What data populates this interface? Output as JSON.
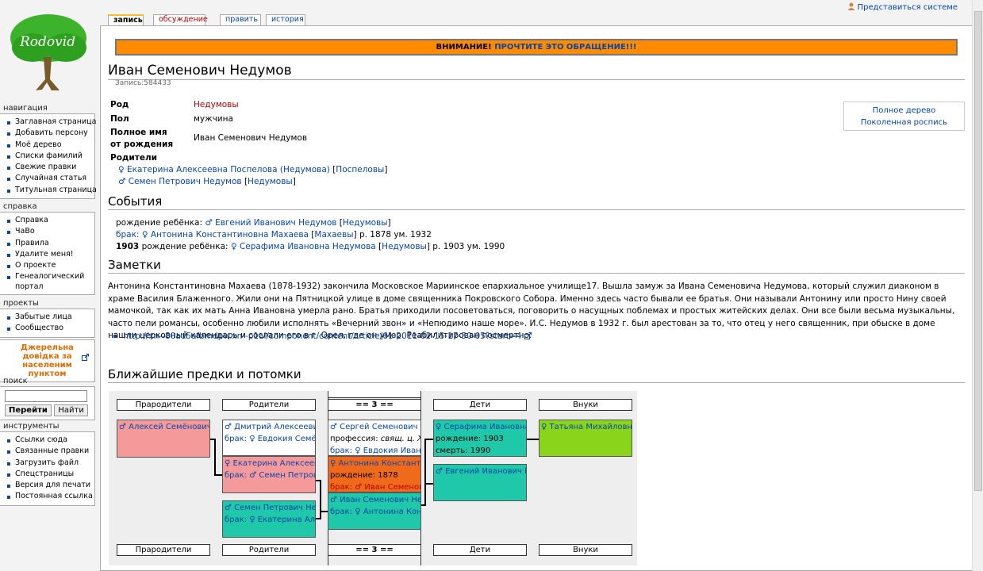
{
  "logo": {
    "text": "Rodovid",
    "icon": "tree-logo"
  },
  "sidebar": {
    "navigation": {
      "title": "навигация",
      "items": [
        "Заглавная страница",
        "Добавить персону",
        "Моё дерево",
        "Списки фамилий",
        "Свежие правки",
        "Случайная статья",
        "Титульная страница"
      ]
    },
    "help": {
      "title": "справка",
      "items": [
        "Справка",
        "ЧаВо",
        "Правила",
        "Удалите меня!",
        "О проекте",
        "Генеалогический портал"
      ]
    },
    "projects": {
      "title": "проекты",
      "items": [
        "Забытые лица",
        "Сообщество"
      ]
    },
    "special": {
      "text": "Джерельна довідка за населеним пунктом",
      "icon": "external-link-icon"
    },
    "search": {
      "title": "поиск",
      "go": "Перейти",
      "find": "Найти"
    },
    "tools": {
      "title": "инструменты",
      "items": [
        "Ссылки сюда",
        "Связанные правки",
        "Загрузить файл",
        "Спецстраницы",
        "Версия для печати",
        "Постоянная ссылка"
      ]
    }
  },
  "top": {
    "login": "Представиться системе",
    "tabs": [
      "запись",
      "обсуждение",
      "править",
      "история"
    ]
  },
  "notice": {
    "prefix": "ВНИМАНИЕ!",
    "link": "ПРОЧТИТЕ ЭТО ОБРАЩЕНИЕ!!!"
  },
  "person": {
    "title": "Иван Семенович Недумов",
    "record": "Запись:584433",
    "rod_label": "Род",
    "rod_value": "Недумовы",
    "sex_label": "Пол",
    "sex_value": "мужчина",
    "fullname_label1": "Полное имя",
    "fullname_label2": "от рождения",
    "fullname_value": "Иван Семенович Недумов",
    "parents_label": "Родители",
    "mother": "♀ Екатерина Алексеевна Поспелова (Недумова)",
    "mother_rod": "Поспеловы",
    "father": "♂ Семен Петрович Недумов",
    "father_rod": "Недумовы"
  },
  "sidebox": {
    "tree": "Полное дерево",
    "list": "Поколенная роспись"
  },
  "events": {
    "title": "События",
    "e1_prefix": "рождение ребёнка:",
    "e1_person": "♂ Евгений Иванович Недумов",
    "e1_rod": "Недумовы",
    "e2_prefix": "брак:",
    "e2_person": "♀ Антонина Константиновна Махаева",
    "e2_rod": "Махаевы",
    "e2_suffix": "р. 1878 ум. 1932",
    "e3_year": "1903",
    "e3_prefix": "рождение ребёнка:",
    "e3_person": "♀ Серафима Ивановна Недумова",
    "e3_rod": "Недумовы",
    "e3_suffix": "р. 1903 ум. 1990"
  },
  "notes": {
    "title": "Заметки",
    "text": "Антонина Константиновна Махаева (1878-1932) закончила Московское Мариинское епархиальное училище17. Вышла замуж за Ивана Семеновича Недумова, который служил диаконом в храме Василия Блаженного. Жили они на Пятницкой улице в доме священника Покровского Собора. Именно здесь часто бывали ее братья. Они называли Антонину или просто Нину своей мамочкой, так как их мать Анна Ивановна умерла рано. Братья приходили посоветоваться, поговорить о насущных поблемах и простых житейских делах. Они все были весьма музыкальны, часто пели романсы, особенно любили исполнять «Вечерний звон» и «Непюдимо наше море». И.С. Недумов в 1932 г. был арестован за то, что отец у него священник, при обыске в доме нашли церковный календарь и сослали его в г. Орел, где он умер. Реабилитирован посмертно.",
    "link": "http://xn--80ad5afbmdpw.xn--p1ai/component/content/article/61-2011-02-15-17-50-05?start=4"
  },
  "tree": {
    "title": "Ближайшие предки и потомки",
    "headers": [
      "Прародители",
      "Родители",
      "== 3 ==",
      "Дети",
      "Внуки"
    ],
    "grand": "♂ Алексей Семёнович Поспелов",
    "par1_name": "♂ Дмитрий Алексеевич Поспелов",
    "par1_marr": "брак: ♀ Евдокия Семёновна",
    "par2_name": "♀ Екатерина Алексеевна Поспелова",
    "par2_marr": "брак: ♂ Семен Петрович Недумов",
    "par3_name": "♂ Семен Петрович Недумов",
    "par3_marr": "брак: ♀ Екатерина Алексеевна",
    "s1_name": "♂ Сергей Семенович Недумов",
    "s1_prof_label": "профессия:",
    "s1_prof": "свящ. ц. Жив",
    "s1_marr": "брак: ♀ Евдокия Ивановна",
    "s2_name": "♀ Антонина Константиновна",
    "s2_birth": "рождение: 1878",
    "s2_marr": "брак: ♂ Иван Семенович",
    "s3_name": "♂ Иван Семенович Недумов",
    "s3_marr": "брак: ♀ Антонина Константиновна",
    "c1_name": "♀ Серафима Ивановна Недумова",
    "c1_birth": "рождение: 1903",
    "c1_death": "смерть: 1990",
    "c2_name": "♂ Евгений Иванович Недумов",
    "g1_name": "♀ Татьяна Михайловна"
  },
  "colors": {
    "female": "#f59a9a",
    "male": "#1ec8a8",
    "spouse": "#ef6a1a",
    "grandchild": "#8ad41c",
    "notice": "#ff8c00"
  }
}
